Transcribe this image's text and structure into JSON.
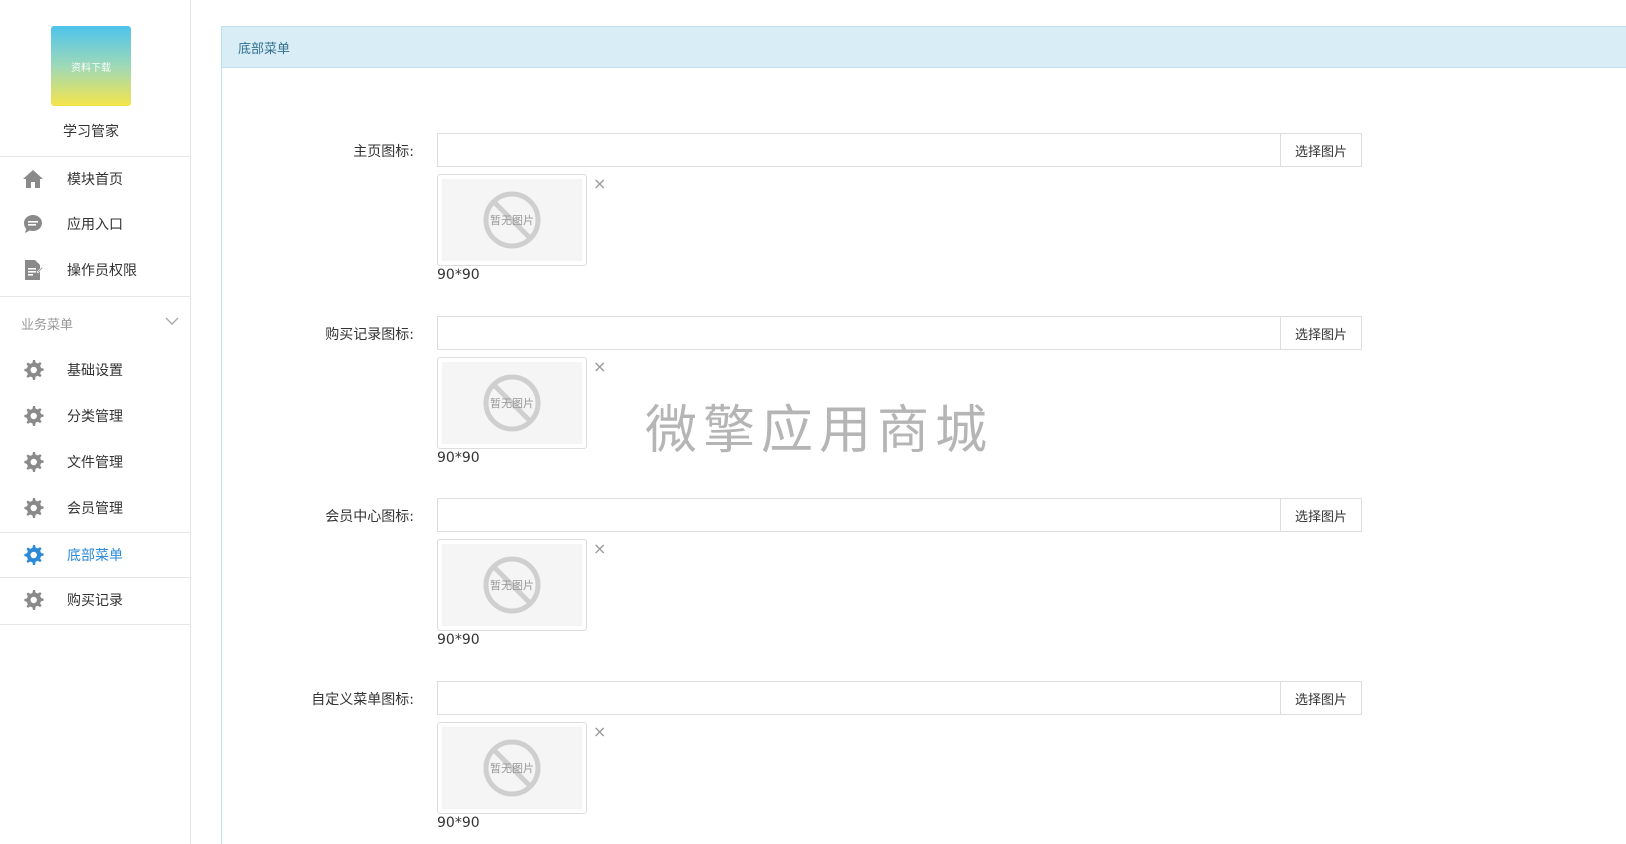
{
  "sidebar": {
    "logo_text": "资料下载",
    "app_name": "学习管家",
    "top_items": [
      {
        "label": "模块首页",
        "icon": "home-icon"
      },
      {
        "label": "应用入口",
        "icon": "chat-icon"
      },
      {
        "label": "操作员权限",
        "icon": "document-edit-icon"
      }
    ],
    "group_label": "业务菜单",
    "group_items": [
      {
        "label": "基础设置",
        "icon": "gear-icon"
      },
      {
        "label": "分类管理",
        "icon": "gear-icon"
      },
      {
        "label": "文件管理",
        "icon": "gear-icon"
      },
      {
        "label": "会员管理",
        "icon": "gear-icon"
      },
      {
        "label": "底部菜单",
        "icon": "gear-icon",
        "active": true
      },
      {
        "label": "购买记录",
        "icon": "gear-icon"
      }
    ]
  },
  "panel": {
    "title": "底部菜单"
  },
  "form": {
    "fields": [
      {
        "label": "主页图标:",
        "value": "",
        "button": "选择图片",
        "placeholder_text": "暂无图片",
        "hint": "90*90"
      },
      {
        "label": "购买记录图标:",
        "value": "",
        "button": "选择图片",
        "placeholder_text": "暂无图片",
        "hint": "90*90"
      },
      {
        "label": "会员中心图标:",
        "value": "",
        "button": "选择图片",
        "placeholder_text": "暂无图片",
        "hint": "90*90"
      },
      {
        "label": "自定义菜单图标:",
        "value": "",
        "button": "选择图片",
        "placeholder_text": "暂无图片",
        "hint": "90*90"
      }
    ],
    "remove_glyph": "×"
  },
  "watermark": "微擎应用商城",
  "colors": {
    "accent": "#2c8ad6",
    "heading_bg": "#d9edf7",
    "heading_text": "#31708f",
    "icon_gray": "#8a8a8a"
  }
}
